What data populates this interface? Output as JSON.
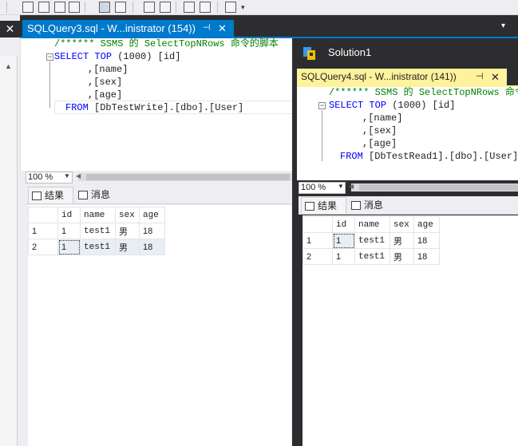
{
  "tabs": {
    "query3": {
      "label": "SQLQuery3.sql - W...inistrator (154))",
      "pin": "⊣",
      "close": "✕"
    },
    "left_tab_close": "✕",
    "overflow": "▾"
  },
  "solution": {
    "title": "Solution1"
  },
  "tabs2": {
    "query4": {
      "label": "SQLQuery4.sql - W...inistrator (141))",
      "pin": "⊣",
      "close": "✕"
    }
  },
  "editor1": {
    "lines": [
      {
        "comment": "/****** SSMS 的 SelectTopNRows 命令的脚本"
      },
      {
        "kw1": "SELECT",
        "kw2": "TOP",
        "paren": "(1000)",
        "field": "[id]"
      },
      {
        "field": ",[name]"
      },
      {
        "field": ",[sex]"
      },
      {
        "field": ",[age]"
      },
      {
        "kw1": "FROM",
        "field": "[DbTestWrite].[dbo].[User]"
      }
    ]
  },
  "editor2": {
    "lines": [
      {
        "comment": "/****** SSMS 的 SelectTopNRows 命令"
      },
      {
        "kw1": "SELECT",
        "kw2": "TOP",
        "paren": "(1000)",
        "field": "[id]"
      },
      {
        "field": ",[name]"
      },
      {
        "field": ",[sex]"
      },
      {
        "field": ",[age]"
      },
      {
        "kw1": "FROM",
        "field": "[DbTestRead1].[dbo].[User]"
      }
    ]
  },
  "zoom1": "100 %",
  "zoom2": "100 %",
  "results1": {
    "tab_results": "结果",
    "tab_messages": "消息",
    "columns": [
      "id",
      "name",
      "sex",
      "age"
    ],
    "rows": [
      {
        "n": "1",
        "id": "1",
        "name": "test1",
        "sex": "男",
        "age": "18"
      },
      {
        "n": "2",
        "id": "1",
        "name": "test1",
        "sex": "男",
        "age": "18"
      }
    ]
  },
  "results2": {
    "tab_results": "结果",
    "tab_messages": "消息",
    "columns": [
      "id",
      "name",
      "sex",
      "age"
    ],
    "rows": [
      {
        "n": "1",
        "id": "1",
        "name": "test1",
        "sex": "男",
        "age": "18"
      },
      {
        "n": "2",
        "id": "1",
        "name": "test1",
        "sex": "男",
        "age": "18"
      }
    ]
  },
  "colors": {
    "tab_active": "#007acc",
    "tab_floating": "#fff29d",
    "chrome_dark": "#2d2d30"
  }
}
